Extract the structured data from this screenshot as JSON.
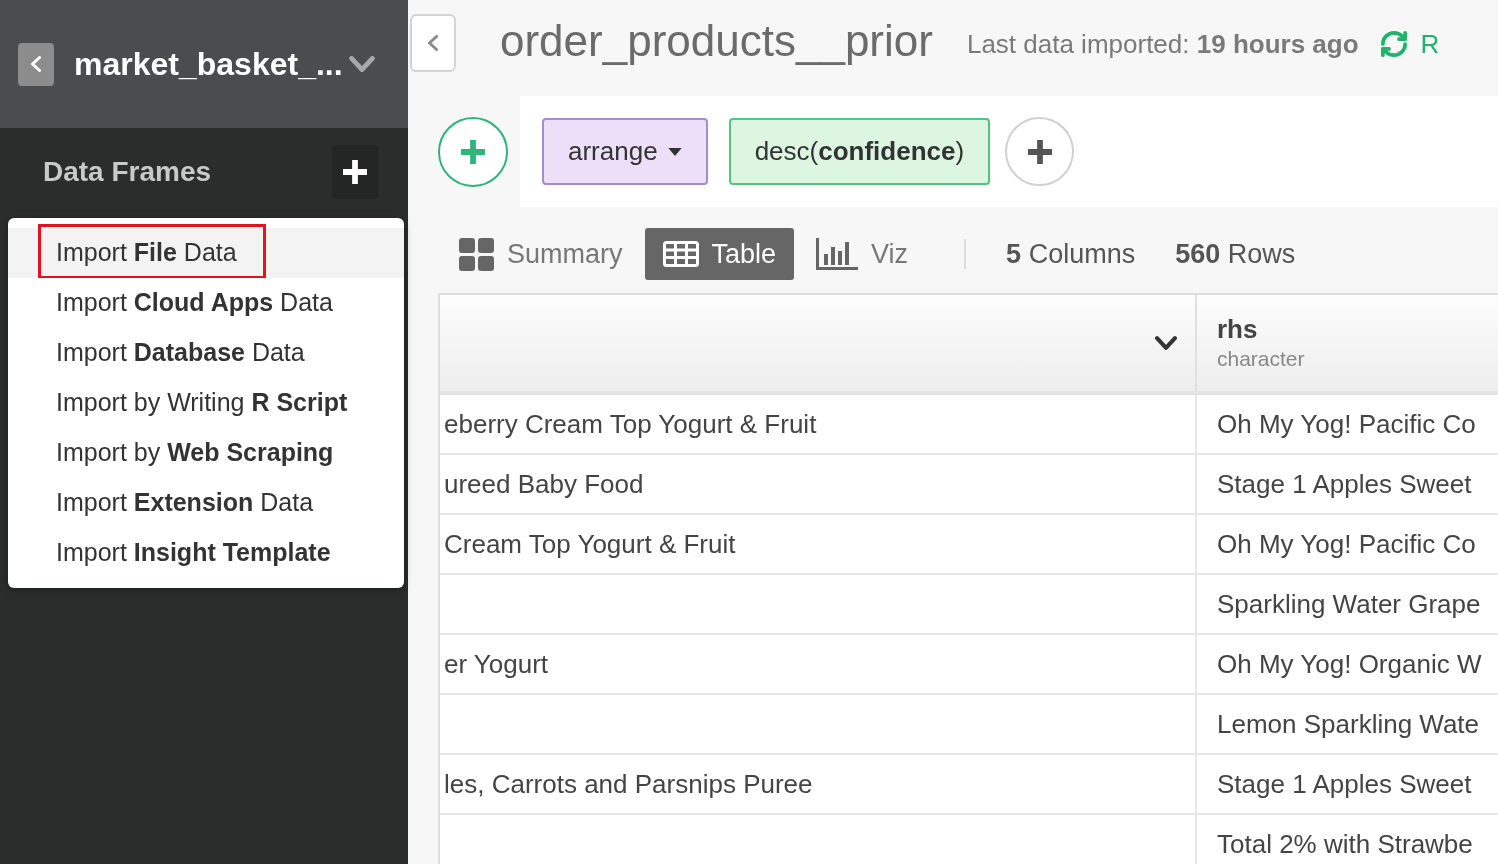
{
  "sidebar": {
    "project_name": "market_basket_...",
    "section_title": "Data Frames"
  },
  "import_menu": {
    "items": [
      {
        "label": "Import **File** Data",
        "selected": true,
        "annotated": true
      },
      {
        "label": "Import **Cloud Apps** Data",
        "selected": false,
        "annotated": false
      },
      {
        "label": "Import **Database** Data",
        "selected": false,
        "annotated": false
      },
      {
        "label": "Import by Writing **R Script**",
        "selected": false,
        "annotated": false
      },
      {
        "label": "Import by **Web Scraping**",
        "selected": false,
        "annotated": false
      },
      {
        "label": "Import **Extension** Data",
        "selected": false,
        "annotated": false
      },
      {
        "label": "Import **Insight Template**",
        "selected": false,
        "annotated": false
      }
    ]
  },
  "header": {
    "title": "order_products__prior",
    "import_status": "Last data imported: **19 hours ago**",
    "refresh_label": "R"
  },
  "pipeline": {
    "steps": [
      {
        "kind": "command",
        "label": "arrange"
      },
      {
        "kind": "argument",
        "label": "desc(**confidence**)"
      }
    ]
  },
  "view_tabs": [
    {
      "label": "Summary",
      "selected": false
    },
    {
      "label": "Table",
      "selected": true
    },
    {
      "label": "Viz",
      "selected": false
    }
  ],
  "stats": [
    "**5** Columns",
    "**560** Rows"
  ],
  "table": {
    "column_2": {
      "name": "rhs",
      "type": "character"
    },
    "rows": [
      {
        "column_1": "eberry Cream Top Yogurt & Fruit",
        "column_2": "Oh My Yog! Pacific Co"
      },
      {
        "column_1": "ureed Baby Food",
        "column_2": "Stage 1 Apples Sweet"
      },
      {
        "column_1": "Cream Top Yogurt & Fruit",
        "column_2": "Oh My Yog! Pacific Co"
      },
      {
        "column_2": "Sparkling Water Grape"
      },
      {
        "column_1": "er Yogurt",
        "column_2": "Oh My Yog! Organic W"
      },
      {
        "column_2": "Lemon Sparkling Wate"
      },
      {
        "column_1": "les, Carrots and Parsnips Puree",
        "column_2": "Stage 1 Apples Sweet"
      },
      {
        "column_2": "Total 2% with Strawbe"
      }
    ]
  }
}
